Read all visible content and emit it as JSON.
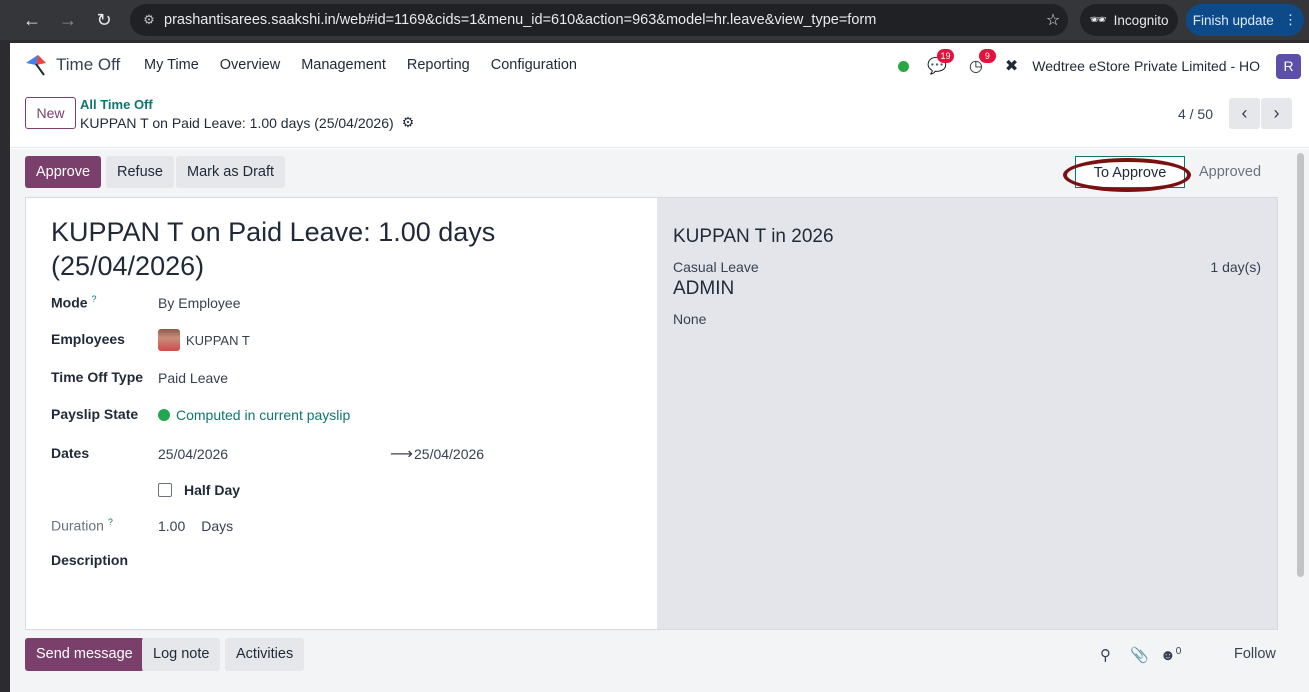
{
  "browser": {
    "url": "prashantisarees.saakshi.in/web#id=1169&cids=1&menu_id=610&action=963&model=hr.leave&view_type=form",
    "incognito_label": "Incognito",
    "finish_update_label": "Finish update"
  },
  "navbar": {
    "app_name": "Time Off",
    "menu": [
      "My Time",
      "Overview",
      "Management",
      "Reporting",
      "Configuration"
    ],
    "messages_count": "19",
    "activities_count": "9",
    "company": "Wedtree eStore Private Limited - HO",
    "user_initial": "R"
  },
  "control_panel": {
    "new_label": "New",
    "breadcrumb_parent": "All Time Off",
    "breadcrumb_current": "KUPPAN T on Paid Leave: 1.00 days (25/04/2026)",
    "pager": "4 / 50"
  },
  "statusbar": {
    "approve_label": "Approve",
    "refuse_label": "Refuse",
    "draft_label": "Mark as Draft",
    "stage_active": "To Approve",
    "stage_next": "Approved"
  },
  "form": {
    "title": "KUPPAN T on Paid Leave: 1.00 days (25/04/2026)",
    "mode_label": "Mode",
    "mode_value": "By Employee",
    "employees_label": "Employees",
    "employee_name": "KUPPAN T",
    "type_label": "Time Off Type",
    "type_value": "Paid Leave",
    "payslip_label": "Payslip State",
    "payslip_value": "Computed in current payslip",
    "dates_label": "Dates",
    "date_from": "25/04/2026",
    "date_to": "25/04/2026",
    "half_day_label": "Half Day",
    "duration_label": "Duration",
    "duration_value": "1.00",
    "duration_unit": "Days",
    "description_label": "Description",
    "help_mark": "?"
  },
  "side_panel": {
    "title": "KUPPAN T in 2026",
    "leave_type": "Casual Leave",
    "leave_days": "1 day(s)",
    "department": "ADMIN",
    "manager": "None"
  },
  "chatter": {
    "send_message_label": "Send message",
    "log_note_label": "Log note",
    "activities_label": "Activities",
    "followers_count": "0",
    "follow_label": "Follow"
  }
}
